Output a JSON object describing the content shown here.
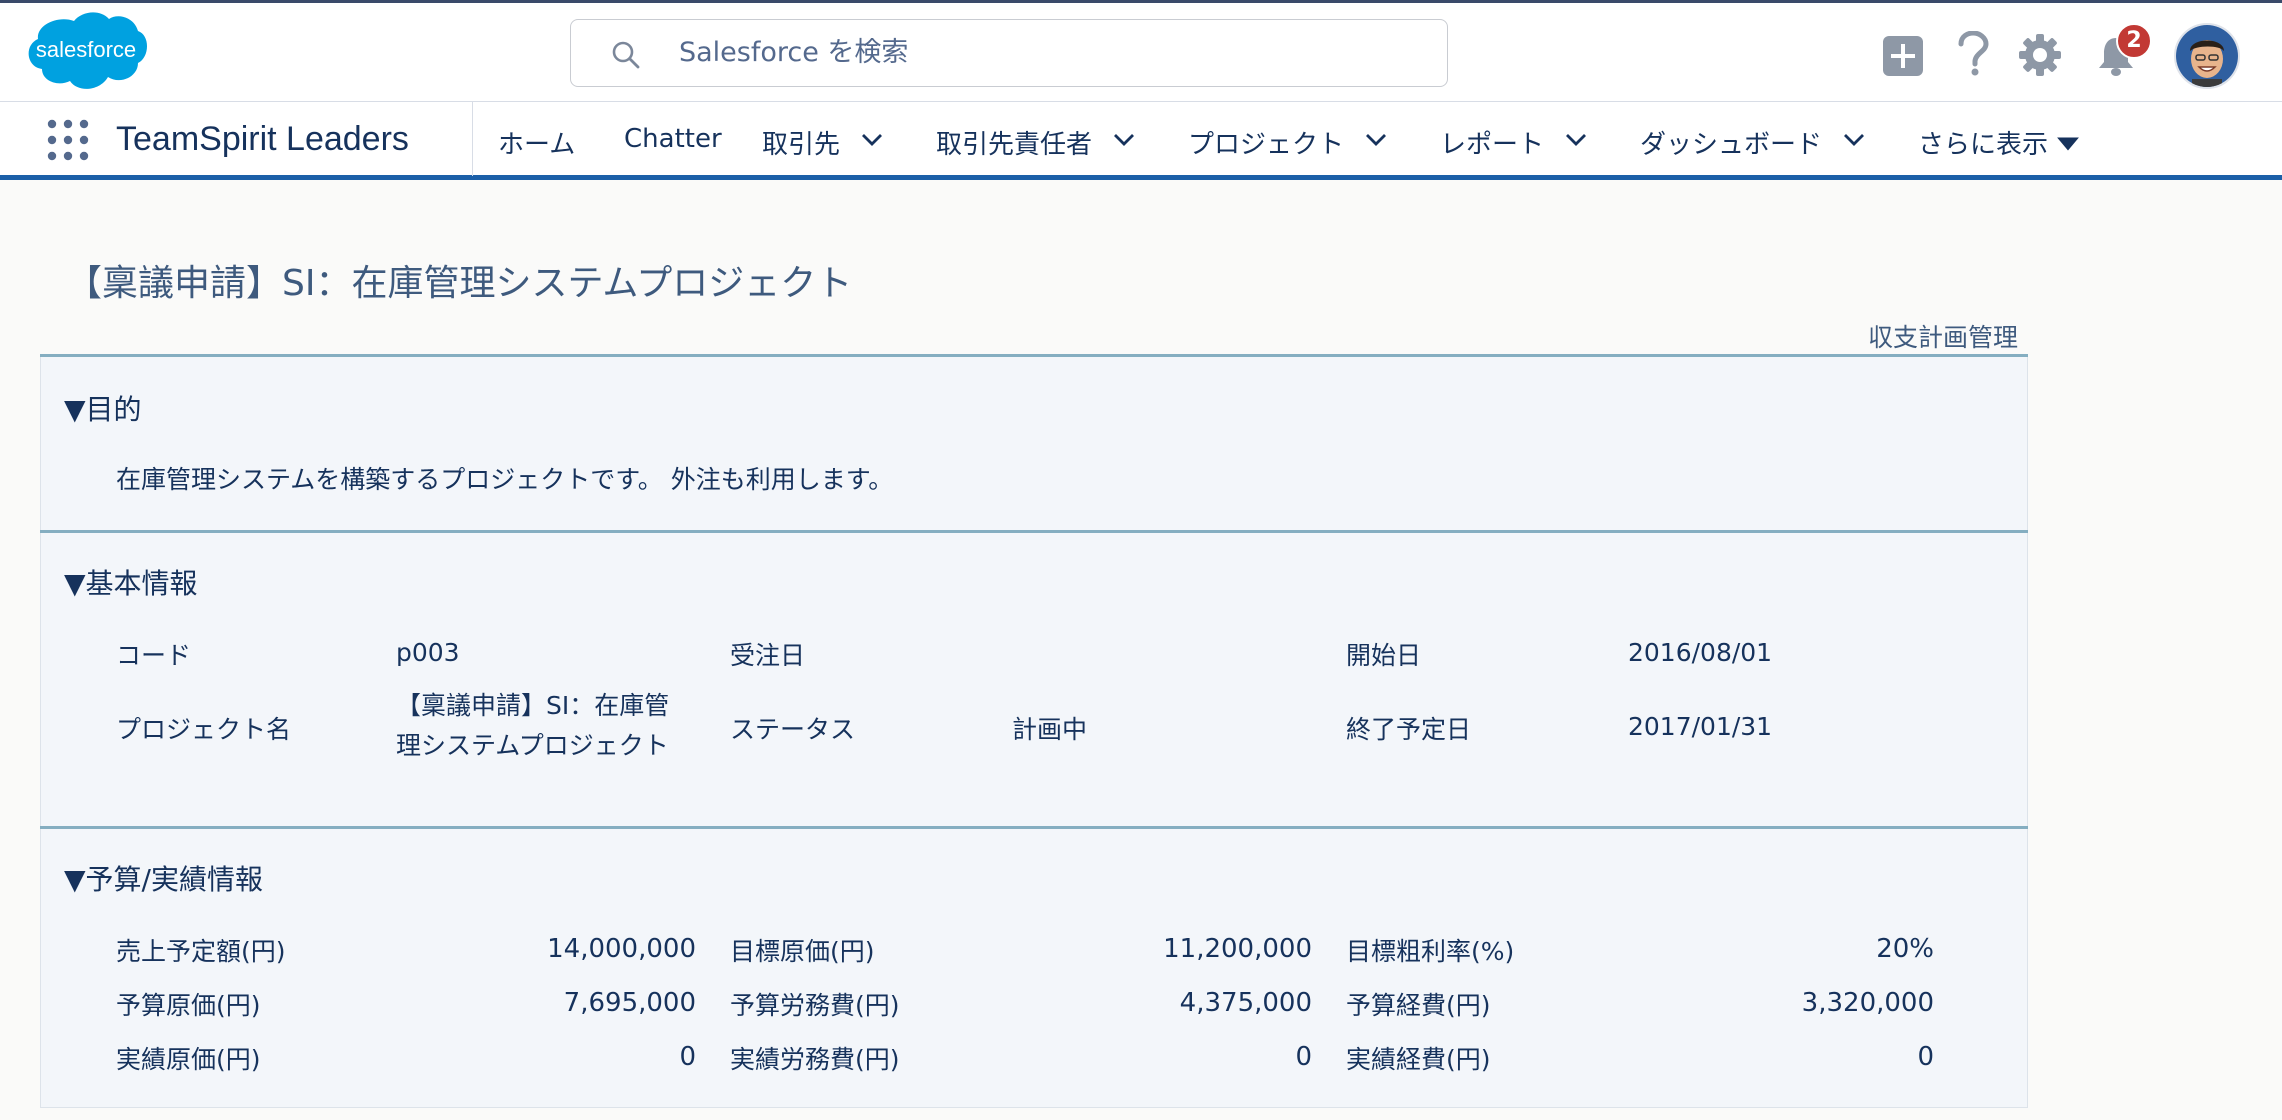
{
  "header": {
    "logo_text": "salesforce",
    "search_placeholder": "Salesforce を検索",
    "notification_count": "2",
    "icons": [
      "plus-icon",
      "help-icon",
      "gear-icon",
      "bell-icon",
      "avatar"
    ]
  },
  "nav": {
    "app_name": "TeamSpirit Leaders",
    "items": [
      {
        "label": "ホーム",
        "has_menu": false
      },
      {
        "label": "Chatter",
        "has_menu": false
      },
      {
        "label": "取引先",
        "has_menu": true
      },
      {
        "label": "取引先責任者",
        "has_menu": true
      },
      {
        "label": "プロジェクト",
        "has_menu": true
      },
      {
        "label": "レポート",
        "has_menu": true
      },
      {
        "label": "ダッシュボード",
        "has_menu": true
      },
      {
        "label": "さらに表示",
        "has_menu": true
      }
    ]
  },
  "page": {
    "title": "【稟議申請】SI：在庫管理システムプロジェクト",
    "budget_link": "収支計画管理",
    "purpose": {
      "heading": "▼目的",
      "text": "在庫管理システムを構築するプロジェクトです。 外注も利用します。"
    },
    "basic": {
      "heading": "▼基本情報",
      "code_label": "コード",
      "code_value": "p003",
      "order_date_label": "受注日",
      "order_date_value": "",
      "start_label": "開始日",
      "start_value": "2016/08/01",
      "name_label": "プロジェクト名",
      "name_value": "【稟議申請】SI：在庫管理システムプロジェクト",
      "status_label": "ステータス",
      "status_value": "計画中",
      "end_label": "終了予定日",
      "end_value": "2017/01/31"
    },
    "budget": {
      "heading": "▼予算/実績情報",
      "rows": [
        [
          {
            "label": "売上予定額(円)",
            "value": "14,000,000"
          },
          {
            "label": "目標原価(円)",
            "value": "11,200,000"
          },
          {
            "label": "目標粗利率(%)",
            "value": "20%"
          }
        ],
        [
          {
            "label": "予算原価(円)",
            "value": "7,695,000"
          },
          {
            "label": "予算労務費(円)",
            "value": "4,375,000"
          },
          {
            "label": "予算経費(円)",
            "value": "3,320,000"
          }
        ],
        [
          {
            "label": "実績原価(円)",
            "value": "0"
          },
          {
            "label": "実績労務費(円)",
            "value": "0"
          },
          {
            "label": "実績経費(円)",
            "value": "0"
          }
        ]
      ]
    }
  },
  "colors": {
    "brand": "#00a1e0",
    "nav_accent": "#1b5fa8",
    "section_rule": "#85aec1",
    "badge": "#c23934"
  }
}
